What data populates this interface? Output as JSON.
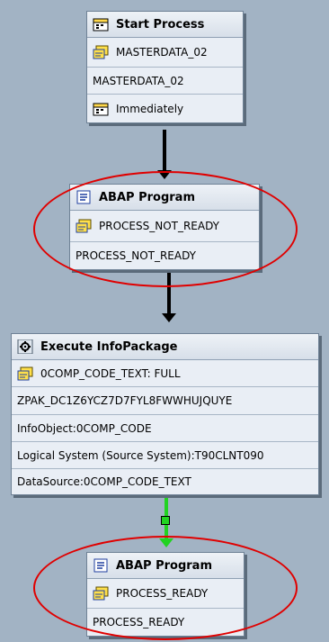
{
  "start_process": {
    "title": "Start Process",
    "variant": "MASTERDATA_02",
    "description": "MASTERDATA_02",
    "scheduling": "Immediately"
  },
  "abap_program_1": {
    "title": "ABAP Program",
    "variant": "PROCESS_NOT_READY",
    "description": "PROCESS_NOT_READY"
  },
  "execute_infopackage": {
    "title": "Execute InfoPackage",
    "variant": "0COMP_CODE_TEXT: FULL",
    "package_id": "ZPAK_DC1Z6YCZ7D7FYL8FWWHUJQUYE",
    "infoobject": "InfoObject:0COMP_CODE",
    "logical_system": "Logical System (Source System):T90CLNT090",
    "datasource": "DataSource:0COMP_CODE_TEXT"
  },
  "abap_program_2": {
    "title": "ABAP Program",
    "variant": "PROCESS_READY",
    "description": "PROCESS_READY"
  },
  "colors": {
    "canvas": "#a2b3c4",
    "node_bg": "#e9eef5",
    "connector": "#000000",
    "success_connector": "#22d322",
    "highlight_ellipse": "#e00000"
  }
}
